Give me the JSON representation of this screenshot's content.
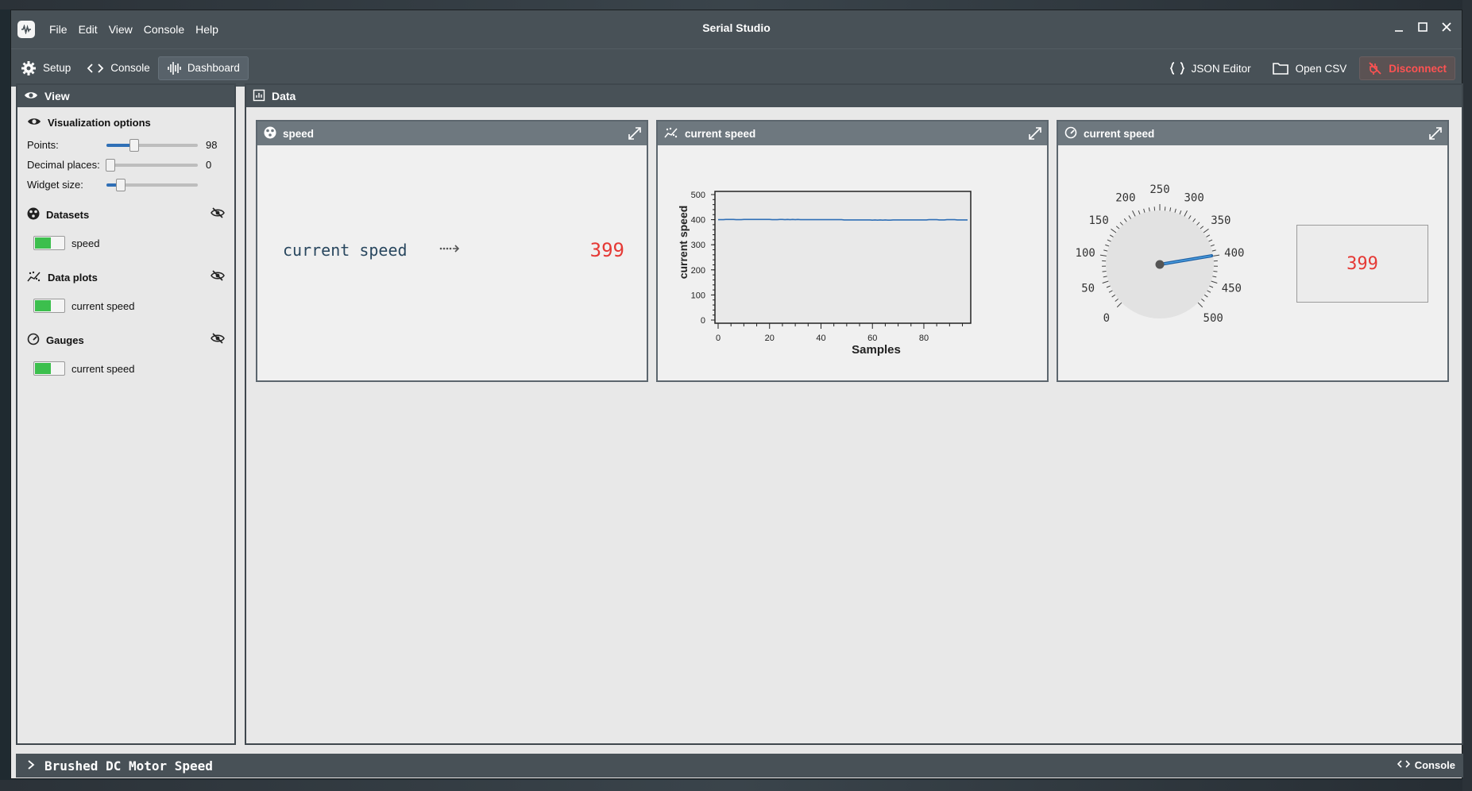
{
  "window": {
    "title": "Serial Studio"
  },
  "menu": [
    "File",
    "Edit",
    "View",
    "Console",
    "Help"
  ],
  "toolbar": {
    "setup": "Setup",
    "console": "Console",
    "dashboard": "Dashboard",
    "json_editor": "JSON Editor",
    "open_csv": "Open CSV",
    "disconnect": "Disconnect"
  },
  "view_panel": {
    "title": "View",
    "visualization_title": "Visualization options",
    "sliders": [
      {
        "label": "Points:",
        "value": "98",
        "fraction": 0.3
      },
      {
        "label": "Decimal places:",
        "value": "0",
        "fraction": 0.04
      },
      {
        "label": "Widget size:",
        "value": "",
        "fraction": 0.16
      }
    ],
    "datasets_title": "Datasets",
    "datasets_items": [
      "speed"
    ],
    "plots_title": "Data plots",
    "plots_items": [
      "current speed"
    ],
    "gauges_title": "Gauges",
    "gauges_items": [
      "current speed"
    ]
  },
  "data_panel": {
    "title": "Data",
    "widgets": [
      {
        "title": "speed",
        "label": "current speed",
        "value": "399"
      },
      {
        "title": "current speed"
      },
      {
        "title": "current speed",
        "value": "399"
      }
    ]
  },
  "chart_data": [
    {
      "type": "line",
      "ylabel": "current speed",
      "xlabel": "Samples",
      "xlim": [
        0,
        97
      ],
      "ylim": [
        0,
        500
      ],
      "x_ticks": [
        "0",
        "20",
        "40",
        "60",
        "80"
      ],
      "y_ticks": [
        "0",
        "100",
        "200",
        "300",
        "400",
        "500"
      ],
      "grid": false,
      "series": [
        {
          "values": [
            400,
            400,
            400,
            401,
            401,
            401,
            401,
            400,
            400,
            400,
            401,
            401,
            401,
            401,
            401,
            401,
            401,
            401,
            401,
            401,
            401,
            400,
            400,
            400,
            401,
            401,
            400,
            401,
            400,
            401,
            400,
            401,
            400,
            400,
            400,
            400,
            400,
            400,
            400,
            400,
            400,
            400,
            400,
            400,
            400,
            400,
            400,
            400,
            400,
            399,
            399,
            399,
            399,
            399,
            399,
            399,
            399,
            399,
            399,
            399,
            398,
            399,
            398,
            399,
            398,
            399,
            398,
            398,
            399,
            399,
            399,
            399,
            399,
            399,
            399,
            399,
            399,
            399,
            399,
            399,
            399,
            399,
            400,
            400,
            400,
            400,
            399,
            399,
            399,
            400,
            400,
            400,
            400,
            399,
            399,
            399,
            399,
            399
          ]
        }
      ]
    },
    {
      "type": "gauge",
      "min": 0,
      "max": 500,
      "value": 399,
      "tick_labels": [
        "0",
        "50",
        "100",
        "150",
        "200",
        "250",
        "300",
        "350",
        "400",
        "450",
        "500"
      ]
    }
  ],
  "statusbar": {
    "project": "Brushed DC Motor Speed",
    "console": "Console"
  },
  "colors": {
    "accent": "#2f6fb6",
    "value_red": "#e53935",
    "toggle_on": "#3cbf4d",
    "bar": "#485157"
  }
}
